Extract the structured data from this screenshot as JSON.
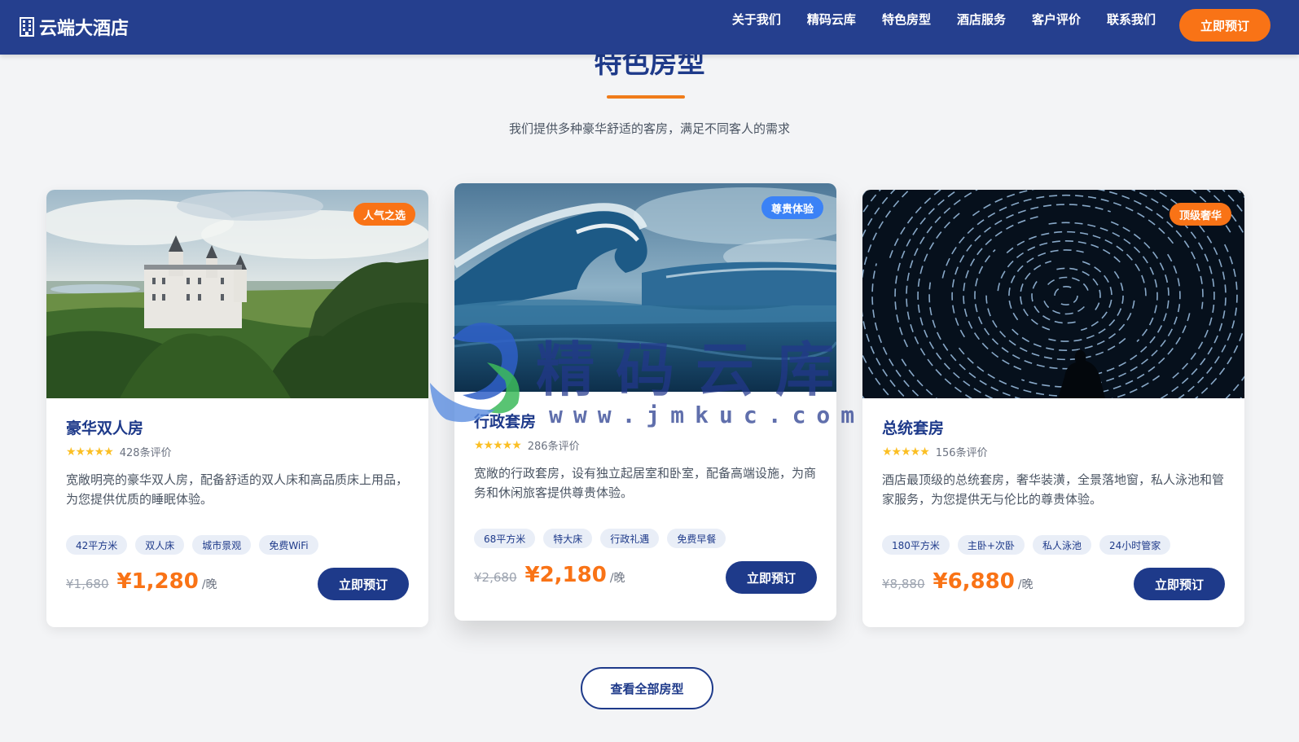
{
  "navbar": {
    "brand": "云端大酒店",
    "links": [
      "关于我们",
      "精码云库",
      "特色房型",
      "酒店服务",
      "客户评价",
      "联系我们"
    ],
    "cta": "立即预订"
  },
  "section": {
    "title": "特色房型",
    "subtitle": "我们提供多种豪华舒适的客房，满足不同客人的需求"
  },
  "rooms": [
    {
      "badge": "人气之选",
      "badge_color": "#f97316",
      "name": "豪华双人房",
      "stars": "★★★★★",
      "rating": 5,
      "reviews": "428条评价",
      "description": "宽敞明亮的豪华双人房，配备舒适的双人床和高品质床上用品，为您提供优质的睡眠体验。",
      "tags": [
        "42平方米",
        "双人床",
        "城市景观",
        "免费WiFi"
      ],
      "old_price": "¥1,680",
      "price": "¥1,280",
      "unit": "/晚",
      "book_label": "立即预订"
    },
    {
      "badge": "尊贵体验",
      "badge_color": "#3b82f6",
      "name": "行政套房",
      "stars": "★★★★★",
      "rating": 5,
      "reviews": "286条评价",
      "description": "宽敞的行政套房，设有独立起居室和卧室，配备高端设施，为商务和休闲旅客提供尊贵体验。",
      "tags": [
        "68平方米",
        "特大床",
        "行政礼遇",
        "免费早餐"
      ],
      "old_price": "¥2,680",
      "price": "¥2,180",
      "unit": "/晚",
      "book_label": "立即预订"
    },
    {
      "badge": "顶级奢华",
      "badge_color": "#f97316",
      "name": "总统套房",
      "stars": "★★★★★",
      "rating": 5,
      "reviews": "156条评价",
      "description": "酒店最顶级的总统套房，奢华装潢，全景落地窗，私人泳池和管家服务，为您提供无与伦比的尊贵体验。",
      "tags": [
        "180平方米",
        "主卧+次卧",
        "私人泳池",
        "24小时管家"
      ],
      "old_price": "¥8,880",
      "price": "¥6,880",
      "unit": "/晚",
      "book_label": "立即预订"
    }
  ],
  "view_all": "查看全部房型",
  "watermark": {
    "text": "精码云库",
    "url": "www.jmkuc.com"
  },
  "colors": {
    "primary": "#1e3a8a",
    "navbar": "#253f8e",
    "accent": "#f97316"
  }
}
